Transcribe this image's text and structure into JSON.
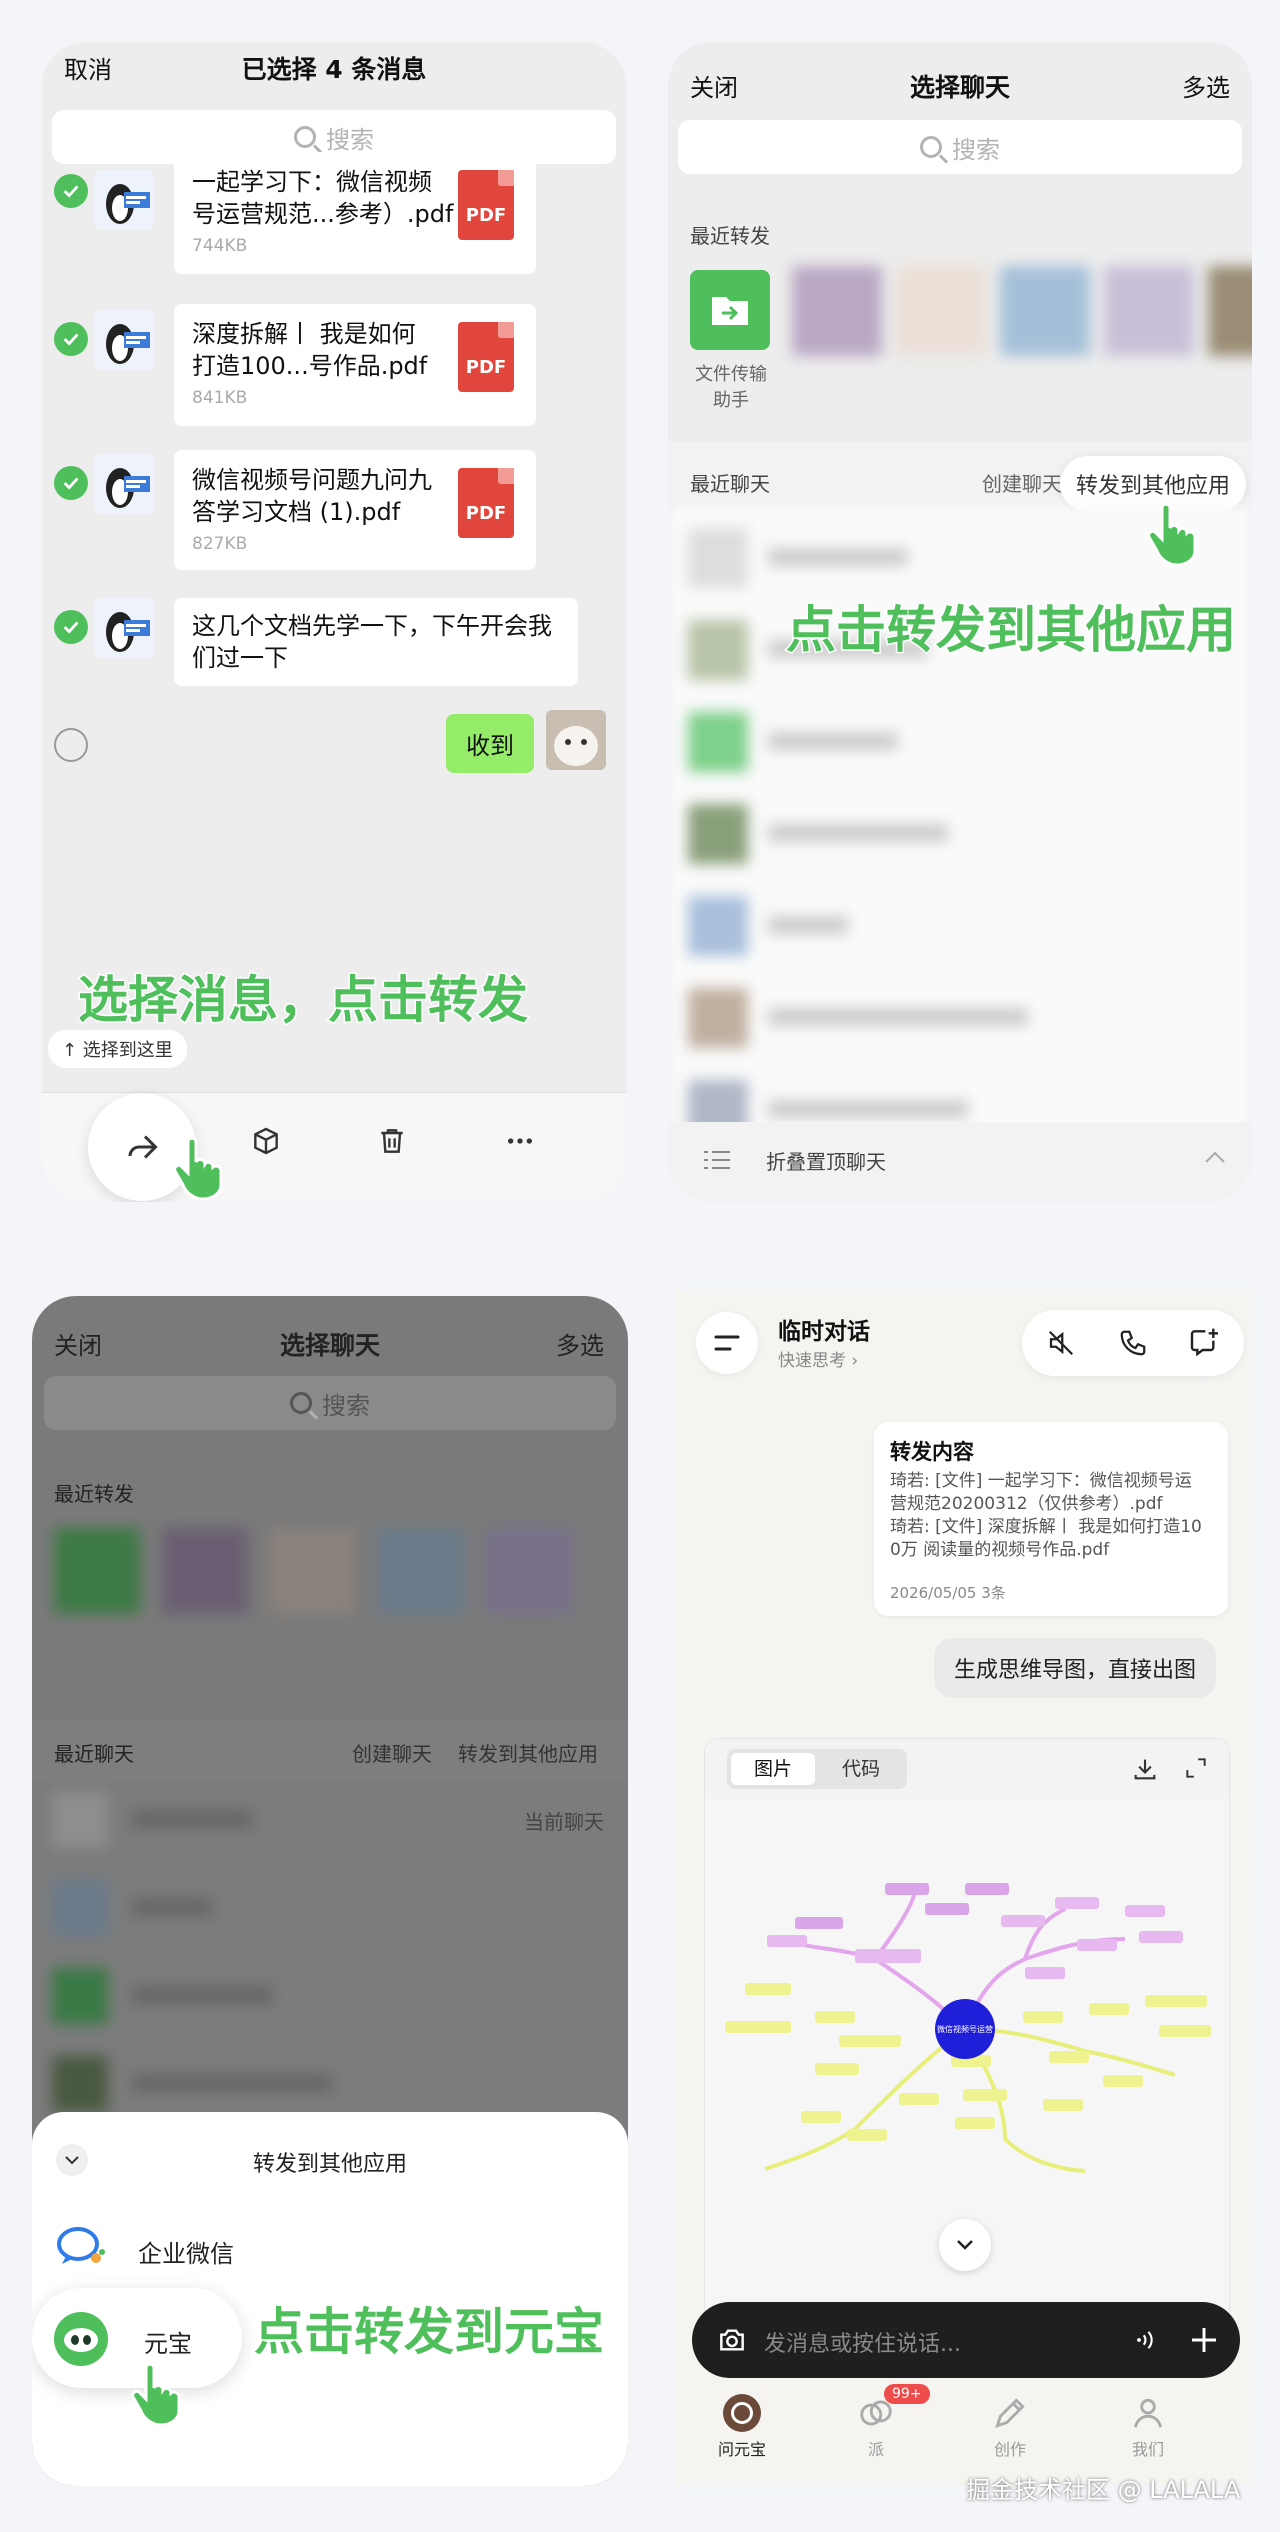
{
  "panel1": {
    "cancel_label": "取消",
    "title": "已选择 4 条消息",
    "search_placeholder": "搜索",
    "files": [
      {
        "title_line1": "一起学习下：微信视频",
        "title_line2": "号运营规范...参考）.pdf",
        "size": "744KB"
      },
      {
        "title_line1": "深度拆解丨 我是如何",
        "title_line2": "打造100...号作品.pdf",
        "size": "841KB"
      },
      {
        "title_line1": "微信视频号问题九问九",
        "title_line2": "答学习文档 (1).pdf",
        "size": "827KB"
      }
    ],
    "pdf_label": "PDF",
    "text_message_line1": "这几个文档先学一下，下午开会我",
    "text_message_line2": "们过一下",
    "reply_message": "收到",
    "select_to_here": "↑ 选择到这里",
    "caption": "选择消息，点击转发"
  },
  "panel2": {
    "close_label": "关闭",
    "title": "选择聊天",
    "multi_label": "多选",
    "search_placeholder": "搜索",
    "recent_forward_label": "最近转发",
    "file_helper_line1": "文件传输",
    "file_helper_line2": "助手",
    "recent_chats_label": "最近聊天",
    "create_chat_label": "创建聊天",
    "forward_other_app": "转发到其他应用",
    "caption": "点击转发到其他应用",
    "collapse_pinned": "折叠置顶聊天"
  },
  "panel3": {
    "close_label": "关闭",
    "title": "选择聊天",
    "multi_label": "多选",
    "search_placeholder": "搜索",
    "recent_forward_label": "最近转发",
    "recent_chats_label": "最近聊天",
    "create_chat_label": "创建聊天",
    "forward_other_app": "转发到其他应用",
    "current_chat_label": "当前聊天",
    "sheet_title": "转发到其他应用",
    "apps": [
      "企业微信",
      "元宝"
    ],
    "caption": "点击转发到元宝"
  },
  "panel4": {
    "title": "临时对话",
    "subtitle": "快速思考 ›",
    "forward_card_title": "转发内容",
    "forward_line1": "琦若: [文件] 一起学习下：微信视频号运",
    "forward_line2": "营规范20200312（仅供参考）.pdf",
    "forward_line3": "琦若: [文件] 深度拆解丨 我是如何打造10",
    "forward_line4": "0万 阅读量的视频号作品.pdf",
    "forward_meta": "2026/05/05  3条",
    "user_message": "生成思维导图，直接出图",
    "tab_image": "图片",
    "tab_code": "代码",
    "mindmap_center": "微信视频号运营",
    "input_placeholder": "发消息或按住说话...",
    "nav": [
      {
        "label": "问元宝"
      },
      {
        "label": "派",
        "badge": "99+"
      },
      {
        "label": "创作"
      },
      {
        "label": "我们"
      }
    ]
  },
  "watermark": "掘金技术社区 @ LALALA",
  "colors": {
    "green": "#4fbf5c",
    "pdf_red": "#e0463c",
    "mind_blue": "#1f1fd9"
  }
}
